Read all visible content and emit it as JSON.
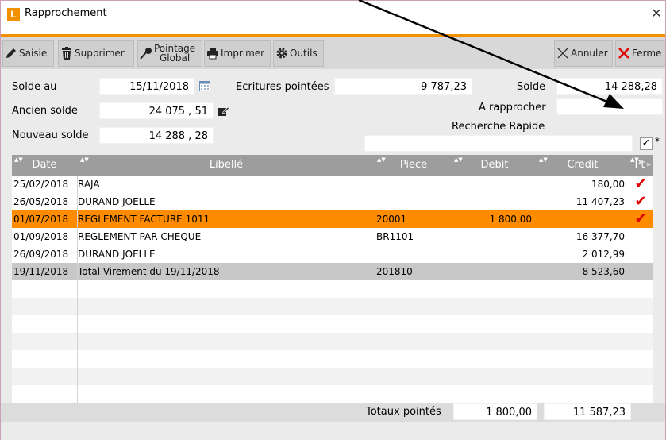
{
  "window": {
    "title": "Rapprochement",
    "logo_letter": "L"
  },
  "toolbar": {
    "saisie": "Saisie",
    "supprimer": "Supprimer",
    "pointage_line1": "Pointage",
    "pointage_line2": "Global",
    "imprimer": "Imprimer",
    "outils": "Outils",
    "annuler": "Annuler",
    "fermer": "Ferme"
  },
  "form": {
    "solde_au_label": "Solde au",
    "solde_au_value": "15/11/2018",
    "ancien_solde_label": "Ancien solde",
    "ancien_solde_value": "24 075 , 51",
    "nouveau_solde_label": "Nouveau solde",
    "nouveau_solde_value": "14 288 , 28",
    "ecritures_label": "Ecritures pointées",
    "ecritures_value": "-9 787,23",
    "solde_label": "Solde",
    "solde_value": "14 288,28",
    "a_rapprocher_label": "A rapprocher",
    "a_rapprocher_value": "",
    "recherche_label": "Recherche Rapide",
    "recherche_value": "",
    "star": "*"
  },
  "grid": {
    "headers": {
      "date": "Date",
      "libelle": "Libellé",
      "piece": "Piece",
      "debit": "Debit",
      "credit": "Credit",
      "pt": "Pt"
    },
    "rows": [
      {
        "date": "25/02/2018",
        "libelle": "RAJA",
        "piece": "",
        "debit": "",
        "credit": "180,00",
        "pt": "✔"
      },
      {
        "date": "26/05/2018",
        "libelle": "DURAND JOELLE",
        "piece": "",
        "debit": "",
        "credit": "11 407,23",
        "pt": "✔"
      },
      {
        "date": "01/07/2018",
        "libelle": "REGLEMENT FACTURE 1011",
        "piece": "20001",
        "debit": "1 800,00",
        "credit": "",
        "pt": "✔"
      },
      {
        "date": "01/09/2018",
        "libelle": "REGLEMENT PAR CHEQUE",
        "piece": "BR1101",
        "debit": "",
        "credit": "16 377,70",
        "pt": ""
      },
      {
        "date": "26/09/2018",
        "libelle": "DURAND JOELLE",
        "piece": "",
        "debit": "",
        "credit": "2 012,99",
        "pt": ""
      },
      {
        "date": "19/11/2018",
        "libelle": "Total Virement du 19/11/2018",
        "piece": "201810",
        "debit": "",
        "credit": "8 523,60",
        "pt": ""
      }
    ]
  },
  "totals": {
    "label": "Totaux pointés",
    "debit": "1 800,00",
    "credit": "11 587,23"
  },
  "colors": {
    "accent": "#f29100",
    "selected_row": "#ff8c00",
    "total_row": "#c8c8c8",
    "check": "#e00000",
    "header": "#9d9d9d"
  }
}
